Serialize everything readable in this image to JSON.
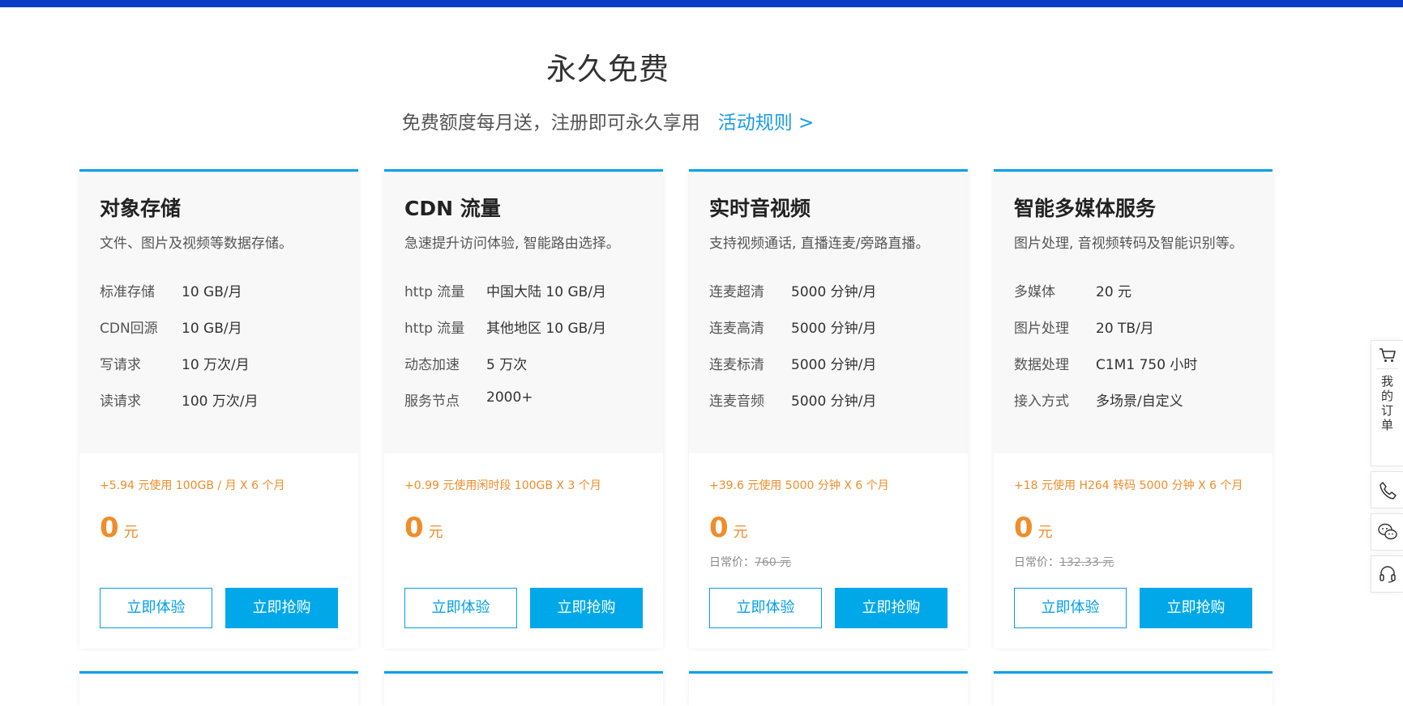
{
  "header": {
    "title": "永久免费",
    "subtitle": "免费额度每月送，注册即可永久享用",
    "rules_link": "活动规则 >"
  },
  "cards": [
    {
      "name": "对象存储",
      "desc": "文件、图片及视频等数据存储。",
      "specs": [
        {
          "label": "标准存储",
          "value": "10 GB/月"
        },
        {
          "label": "CDN回源",
          "value": "10 GB/月"
        },
        {
          "label": "写请求",
          "value": "10 万次/月"
        },
        {
          "label": "读请求",
          "value": "100 万次/月"
        }
      ],
      "promo": "+5.94 元使用 100GB / 月 X 6 个月",
      "price": "0",
      "price_unit": "元",
      "try_label": "立即体验",
      "buy_label": "立即抢购"
    },
    {
      "name": "CDN 流量",
      "desc": "急速提升访问体验, 智能路由选择。",
      "specs": [
        {
          "label": "http 流量",
          "value": "中国大陆 10 GB/月"
        },
        {
          "label": "http 流量",
          "value": "其他地区 10 GB/月"
        },
        {
          "label": "动态加速",
          "value": "5 万次"
        },
        {
          "label": "服务节点",
          "value": "2000+"
        }
      ],
      "promo": "+0.99 元使用闲时段 100GB X 3 个月",
      "price": "0",
      "price_unit": "元",
      "try_label": "立即体验",
      "buy_label": "立即抢购"
    },
    {
      "name": "实时音视频",
      "desc": "支持视频通话, 直播连麦/旁路直播。",
      "specs": [
        {
          "label": "连麦超清",
          "value": "5000 分钟/月"
        },
        {
          "label": "连麦高清",
          "value": "5000 分钟/月"
        },
        {
          "label": "连麦标清",
          "value": "5000 分钟/月"
        },
        {
          "label": "连麦音频",
          "value": "5000 分钟/月"
        }
      ],
      "promo": "+39.6 元使用 5000 分钟 X 6 个月",
      "price": "0",
      "price_unit": "元",
      "orig_label": "日常价：",
      "orig_price": "760 元",
      "try_label": "立即体验",
      "buy_label": "立即抢购"
    },
    {
      "name": "智能多媒体服务",
      "desc": "图片处理, 音视频转码及智能识别等。",
      "specs": [
        {
          "label": "多媒体",
          "value": "20 元"
        },
        {
          "label": "图片处理",
          "value": "20 TB/月"
        },
        {
          "label": "数据处理",
          "value": "C1M1 750 小时"
        },
        {
          "label": "接入方式",
          "value": "多场景/自定义"
        }
      ],
      "promo": "+18 元使用 H264 转码 5000 分钟 X 6 个月",
      "price": "0",
      "price_unit": "元",
      "orig_label": "日常价：",
      "orig_price": "132.33 元",
      "try_label": "立即体验",
      "buy_label": "立即抢购"
    }
  ],
  "sidebar": {
    "cart_icon": "cart-icon",
    "orders_label": [
      "我",
      "的",
      "订",
      "单"
    ],
    "phone_icon": "phone-icon",
    "wechat_icon": "wechat-icon",
    "support_icon": "headset-icon"
  },
  "colors": {
    "accent": "#00a0e9",
    "price": "#f08d2a",
    "topbar": "#0a3cc8"
  }
}
